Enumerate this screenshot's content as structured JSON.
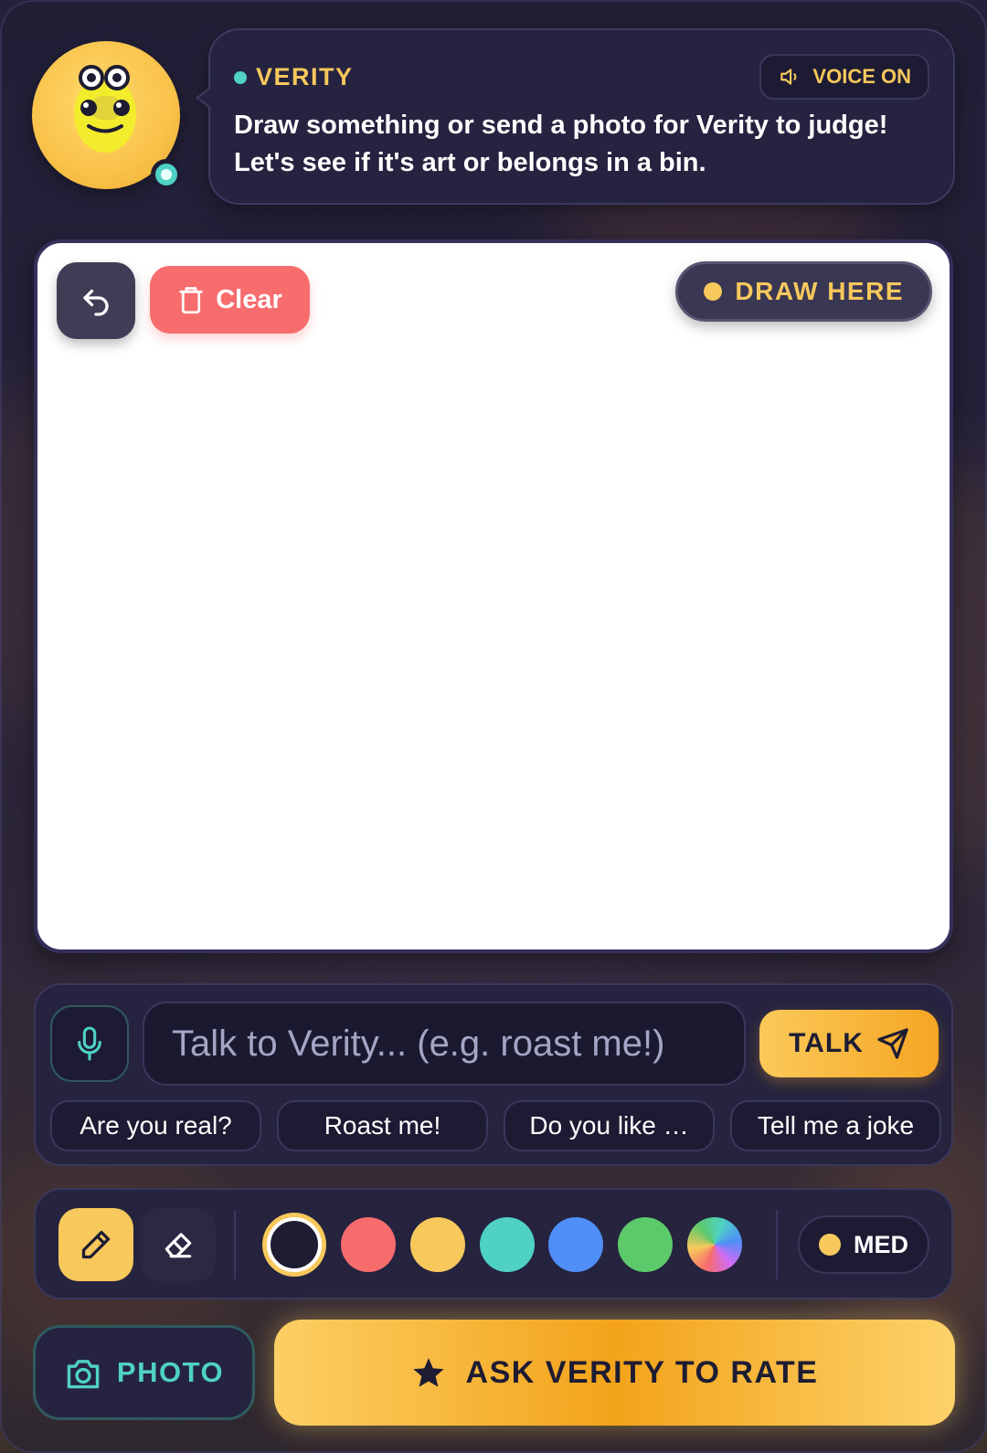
{
  "assistant": {
    "name": "VERITY",
    "voice_label": "VOICE ON",
    "message": "Draw something or send a photo for Verity to judge! Let's see if it's art or belongs in a bin."
  },
  "canvas": {
    "clear_label": "Clear",
    "badge_label": "DRAW HERE"
  },
  "chat": {
    "placeholder": "Talk to Verity... (e.g. roast me!)",
    "value": "",
    "send_label": "TALK",
    "suggestions": [
      "Are you real?",
      "Roast me!",
      "Do you like …",
      "Tell me a joke"
    ]
  },
  "tools": {
    "active_tool": "pencil",
    "colors": [
      "#1e1c33",
      "#f76c6c",
      "#f7c85c",
      "#4fd1c5",
      "#4f8ff7",
      "#5cc96b",
      "rainbow"
    ],
    "selected_color": "#1e1c33",
    "brush_size_label": "MED"
  },
  "actions": {
    "photo_label": "PHOTO",
    "rate_label": "ASK VERITY TO RATE"
  },
  "theme": {
    "accent": "#f7c85c",
    "teal": "#4fd1c5",
    "danger": "#f76c6c",
    "panel": "#25233f"
  }
}
